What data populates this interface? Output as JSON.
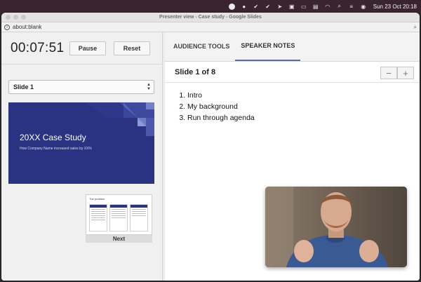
{
  "menubar": {
    "clock": "Sun 23 Oct  20:18",
    "icons": [
      "record-icon",
      "dot-icon",
      "check-icon",
      "check-icon",
      "bird-icon",
      "box-icon",
      "battery-icon",
      "display-icon",
      "wifi-icon",
      "search-icon",
      "control-center-icon",
      "siri-icon"
    ]
  },
  "window": {
    "title": "Presenter view - Case study - Google Slides",
    "address": "about:blank"
  },
  "presenter": {
    "timer": "00:07:51",
    "pause_label": "Pause",
    "reset_label": "Reset",
    "slide_select": "Slide 1",
    "current_slide": {
      "title": "20XX Case Study",
      "subtitle": "How Company Name increased sales by XX%"
    },
    "next_slide": {
      "title": "The problem",
      "label": "Next"
    }
  },
  "notes_panel": {
    "tabs": [
      "AUDIENCE TOOLS",
      "SPEAKER NOTES"
    ],
    "active_tab": "SPEAKER NOTES",
    "slide_counter": "Slide 1 of 8",
    "zoom_out": "−",
    "zoom_in": "+",
    "notes": [
      "Intro",
      "My background",
      "Run through agenda"
    ]
  },
  "colors": {
    "slide_bg": "#2a3382",
    "tab_underline": "#5b6da0",
    "menubar_bg": "#3a2430"
  }
}
